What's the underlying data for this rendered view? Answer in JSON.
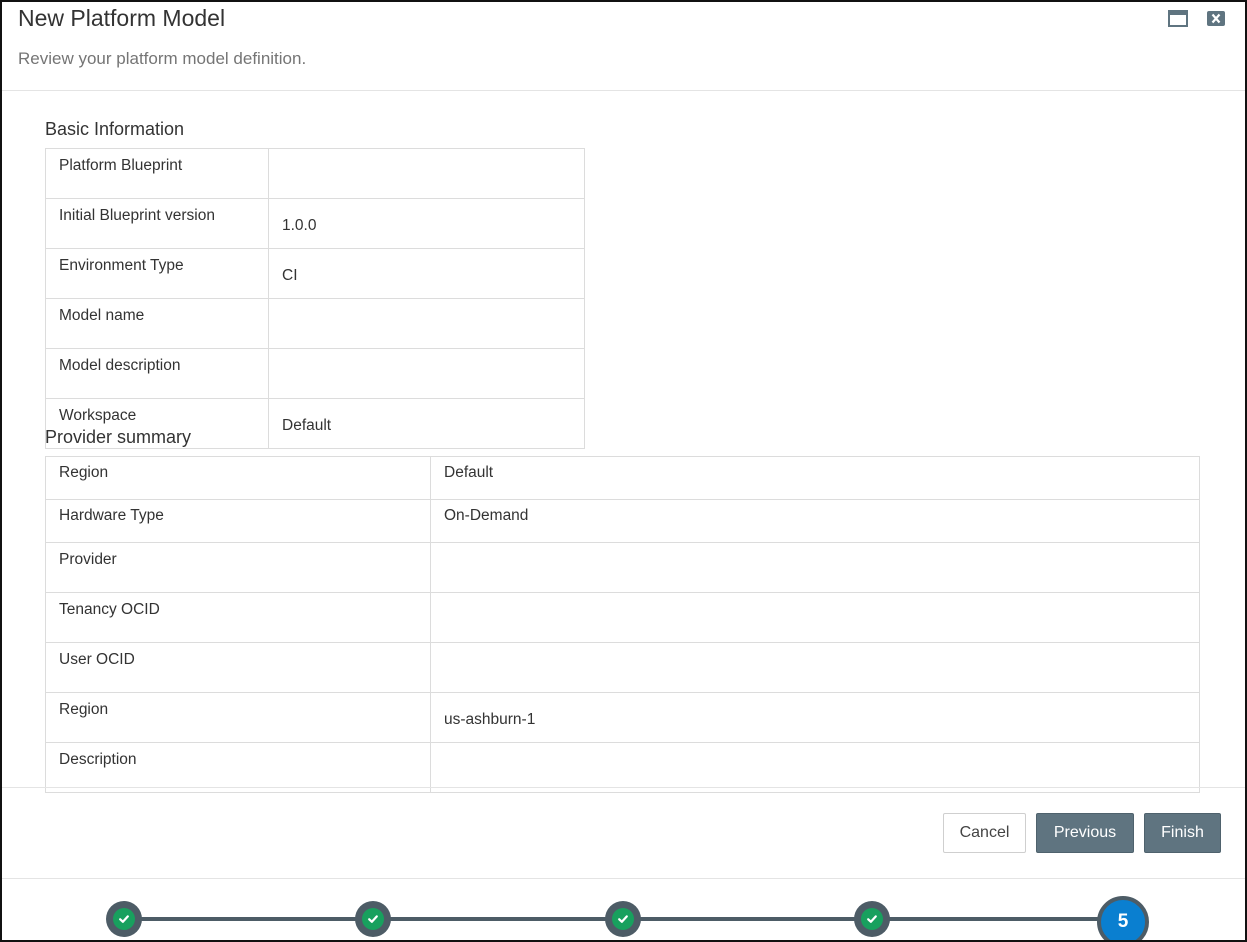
{
  "dialog": {
    "title": "New Platform Model",
    "subtitle": "Review your platform model definition."
  },
  "basic": {
    "heading": "Basic Information",
    "rows": [
      {
        "label": "Platform Blueprint",
        "value": ""
      },
      {
        "label": "Initial Blueprint version",
        "value": "1.0.0"
      },
      {
        "label": "Environment Type",
        "value": "CI"
      },
      {
        "label": "Model name",
        "value": ""
      },
      {
        "label": "Model description",
        "value": ""
      },
      {
        "label": "Workspace",
        "value": "Default"
      }
    ]
  },
  "provider": {
    "heading": "Provider summary",
    "rows": [
      {
        "label": "Region",
        "value": "Default"
      },
      {
        "label": "Hardware Type",
        "value": "On-Demand"
      },
      {
        "label": "Provider",
        "value": ""
      },
      {
        "label": "Tenancy OCID",
        "value": ""
      },
      {
        "label": "User OCID",
        "value": ""
      },
      {
        "label": "Region",
        "value": "us-ashburn-1"
      },
      {
        "label": "Description",
        "value": ""
      }
    ]
  },
  "buttons": {
    "cancel": "Cancel",
    "previous": "Previous",
    "finish": "Finish"
  },
  "steps": {
    "total": 5,
    "current": "5",
    "completed": 4
  },
  "colors": {
    "primary_button": "#5f7480",
    "step_done": "#18a05e",
    "step_current": "#0a7fd0",
    "train_line": "#4d5c66"
  }
}
